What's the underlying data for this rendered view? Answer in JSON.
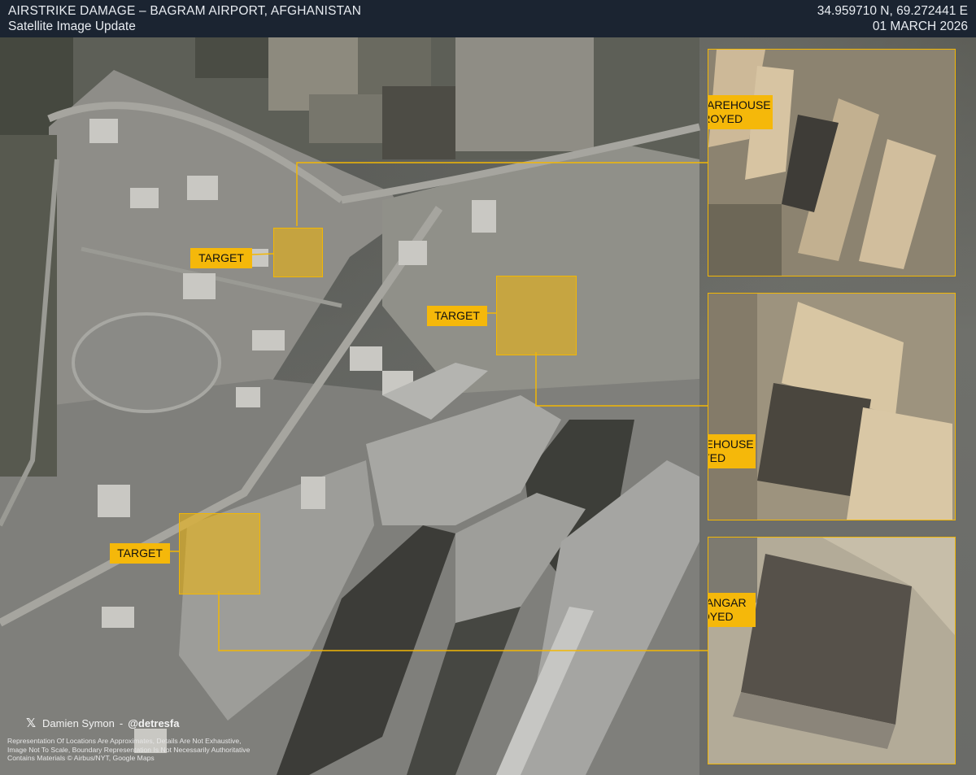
{
  "header": {
    "title": "AIRSTRIKE DAMAGE – BAGRAM AIRPORT, AFGHANISTAN",
    "subtitle": "Satellite Image Update",
    "coordinates": "34.959710 N,  69.272441 E",
    "date": "01 MARCH 2026"
  },
  "targets": [
    {
      "label": "TARGET"
    },
    {
      "label": "TARGET"
    },
    {
      "label": "TARGET"
    }
  ],
  "insets": [
    {
      "caption_line1": "TARGET WAREHOUSE",
      "caption_line2": "DESTROYED"
    },
    {
      "caption_line1": "TARGET WAREHOUSE",
      "caption_line2": "DESTROYED"
    },
    {
      "caption_line1": "TARGET HANGAR",
      "caption_line2": "DESTROYED"
    }
  ],
  "footer": {
    "author": "Damien Symon",
    "separator": "-",
    "handle": "@detresfa",
    "disclaimer_1": "Representation Of Locations Are Approximates, Details Are Not Exhaustive,",
    "disclaimer_2": "Image Not To Scale, Boundary Representation Is Not Necessarily Authoritative",
    "disclaimer_3": "Contains Materials © Airbus/NYT, Google Maps"
  },
  "colors": {
    "accent": "#f5b80a",
    "header_bg": "#1b2431"
  },
  "icons": {
    "brand": "x-logo-icon"
  }
}
